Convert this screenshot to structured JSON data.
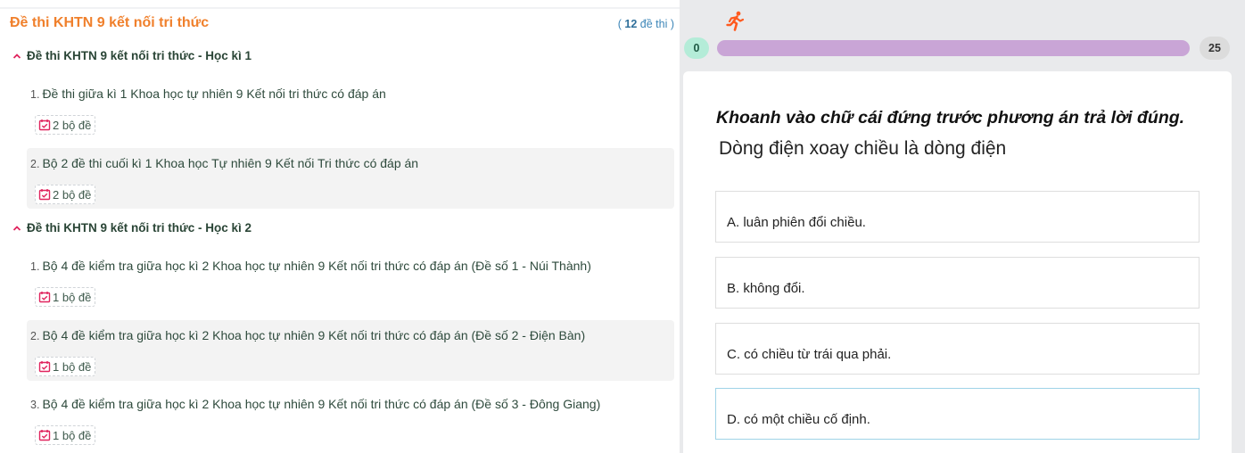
{
  "left_panel": {
    "title": "Đề thi KHTN 9 kết nối tri thức",
    "count_open": "( ",
    "count_value": "12",
    "count_suffix": " đề thi )",
    "sections": [
      {
        "title": "Đề thi KHTN 9 kết nối tri thức - Học kì 1",
        "items": [
          {
            "num": "1.",
            "text": "Đề thi giữa kì 1 Khoa học tự nhiên 9 Kết nối tri thức có đáp án",
            "badge": "2 bộ đề"
          },
          {
            "num": "2.",
            "text": "Bộ 2 đề thi cuối kì 1 Khoa học Tự nhiên 9 Kết nối Tri thức có đáp án",
            "badge": "2 bộ đề"
          }
        ]
      },
      {
        "title": "Đề thi KHTN 9 kết nối tri thức - Học kì 2",
        "items": [
          {
            "num": "1.",
            "text": "Bộ 4 đề kiểm tra giữa học kì 2 Khoa học tự nhiên 9 Kết nối tri thức có đáp án (Đề số 1 - Núi Thành)",
            "badge": "1 bộ đề"
          },
          {
            "num": "2.",
            "text": "Bộ 4 đề kiểm tra giữa học kì 2 Khoa học tự nhiên 9 Kết nối tri thức có đáp án (Đề số 2 - Điện Bàn)",
            "badge": "1 bộ đề"
          },
          {
            "num": "3.",
            "text": "Bộ 4 đề kiểm tra giữa học kì 2 Khoa học tự nhiên 9 Kết nối tri thức có đáp án (Đề số 3 - Đông Giang)",
            "badge": "1 bộ đề"
          }
        ]
      }
    ]
  },
  "quiz": {
    "icon": "runner-icon",
    "score_current": "0",
    "score_total": "25",
    "progress_fraction": 0,
    "instruction": "Khoanh vào chữ cái đứng trước phương án trả lời đúng.",
    "question": "Dòng điện xoay chiều là dòng điện",
    "options": [
      "A. luân phiên đổi chiều.",
      "B. không đổi.",
      "C. có chiều từ trái qua phải.",
      "D. có một chiều cố định."
    ]
  },
  "colors": {
    "title_orange": "#f0802c",
    "section_text": "#2a4536",
    "badge_icon": "#e0245e",
    "progress_track": "#c9a5d6",
    "score_green": "#b4ecd8",
    "runner": "#ff5a1f",
    "selected_border": "#9fd3e7"
  }
}
